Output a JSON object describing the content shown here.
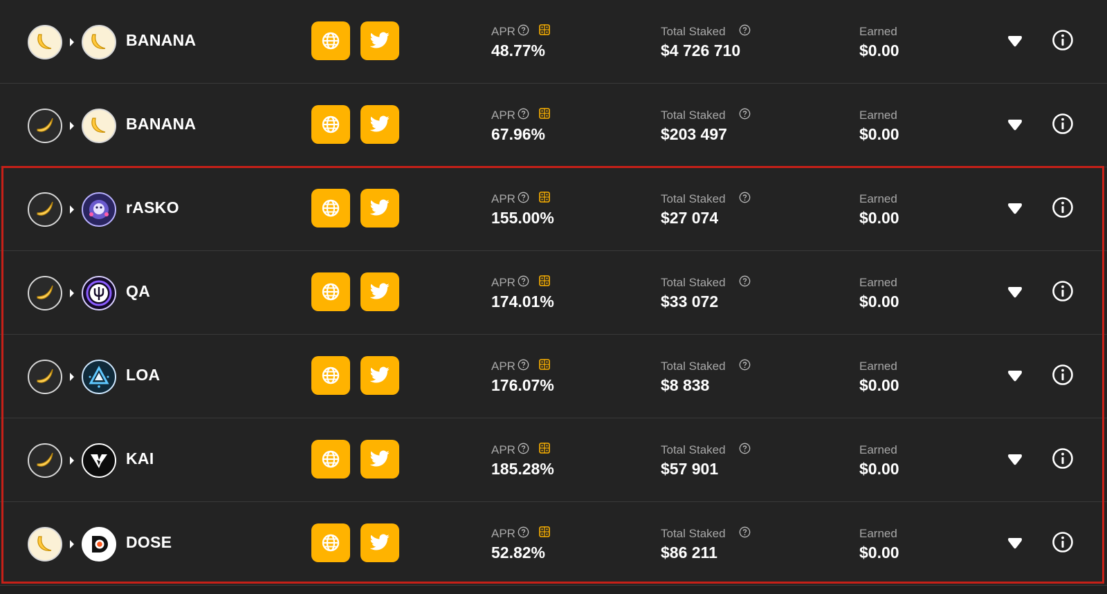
{
  "labels": {
    "apr": "APR",
    "total_staked": "Total Staked",
    "earned": "Earned"
  },
  "colors": {
    "accent": "#ffb300",
    "highlight_border": "#c62018",
    "row_bg": "#232323"
  },
  "pools": [
    {
      "stake_token": "banana",
      "earn_token": "banana",
      "name": "BANANA",
      "apr": "48.77%",
      "total_staked": "$4 726 710",
      "earned": "$0.00"
    },
    {
      "stake_token": "golden-banana",
      "earn_token": "banana",
      "name": "BANANA",
      "apr": "67.96%",
      "total_staked": "$203 497",
      "earned": "$0.00"
    },
    {
      "stake_token": "golden-banana",
      "earn_token": "rasko",
      "name": "rASKO",
      "apr": "155.00%",
      "total_staked": "$27 074",
      "earned": "$0.00"
    },
    {
      "stake_token": "golden-banana",
      "earn_token": "qa",
      "name": "QA",
      "apr": "174.01%",
      "total_staked": "$33 072",
      "earned": "$0.00"
    },
    {
      "stake_token": "golden-banana",
      "earn_token": "loa",
      "name": "LOA",
      "apr": "176.07%",
      "total_staked": "$8 838",
      "earned": "$0.00"
    },
    {
      "stake_token": "golden-banana",
      "earn_token": "kai",
      "name": "KAI",
      "apr": "185.28%",
      "total_staked": "$57 901",
      "earned": "$0.00"
    },
    {
      "stake_token": "banana",
      "earn_token": "dose",
      "name": "DOSE",
      "apr": "52.82%",
      "total_staked": "$86 211",
      "earned": "$0.00"
    }
  ]
}
